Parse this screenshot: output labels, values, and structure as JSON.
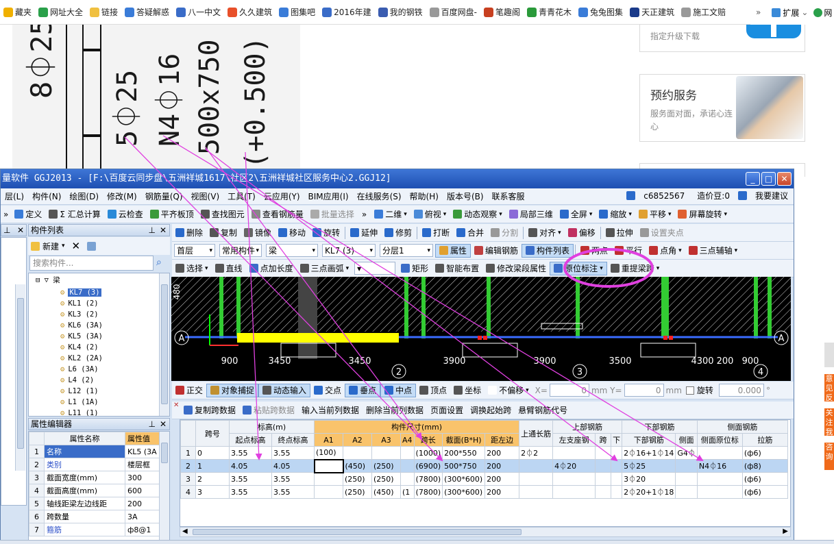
{
  "bookmarks": [
    {
      "label": "藏夹",
      "icon": "star-icon",
      "color": "#f0b000"
    },
    {
      "label": "网址大全",
      "icon": "globe-icon",
      "color": "#2aa04a"
    },
    {
      "label": "链接",
      "icon": "folder-icon",
      "color": "#f0c040"
    },
    {
      "label": "答疑解惑",
      "icon": "refresh-icon",
      "color": "#3a7cd8"
    },
    {
      "label": "八一中文",
      "icon": "arrow-icon",
      "color": "#3a6cc8"
    },
    {
      "label": "久久建筑",
      "icon": "heart-icon",
      "color": "#e8502a"
    },
    {
      "label": "图集吧",
      "icon": "book-icon",
      "color": "#3a7cd8"
    },
    {
      "label": "2016年建",
      "icon": "grid-icon",
      "color": "#3a6cc8"
    },
    {
      "label": "我的钢铁",
      "icon": "news-icon",
      "color": "#3a5cb0"
    },
    {
      "label": "百度网盘-",
      "icon": "page-icon",
      "color": "#999999"
    },
    {
      "label": "笔趣阁",
      "icon": "house-icon",
      "color": "#c84020"
    },
    {
      "label": "青青花木",
      "icon": "leaf-icon",
      "color": "#2a9a3a"
    },
    {
      "label": "兔兔图集",
      "icon": "bunny-icon",
      "color": "#3a7cd8"
    },
    {
      "label": "天正建筑",
      "icon": "house-icon",
      "color": "#1a3a8a"
    },
    {
      "label": "施工文赔",
      "icon": "page-icon",
      "color": "#999999"
    }
  ],
  "bookmarks_more": "»",
  "ext_label": "扩展",
  "ext_after": "网",
  "drawing": {
    "texts": [
      "8⏀25",
      "5⏀25",
      "N4⏀16",
      "500x750",
      "(+0.500)"
    ]
  },
  "ads": {
    "upgrade_text": "指定升级下载",
    "service_title": "预约服务",
    "service_text": "服务面对面，承诺心连心"
  },
  "side_tabs": [
    "意见反",
    "关注我",
    "咨询"
  ],
  "window": {
    "title": "量软件 GGJ2013 - [F:\\百度云同步盘\\五洲祥城1617\\社区2\\五洲祥城社区服务中心2.GGJ12]",
    "min": "_",
    "max": "□",
    "close": "✕"
  },
  "menu": {
    "items": [
      "层(L)",
      "构件(N)",
      "绘图(D)",
      "修改(M)",
      "钢筋量(Q)",
      "视图(V)",
      "工具(T)",
      "云应用(Y)",
      "BIM应用(I)",
      "在线服务(S)",
      "帮助(H)",
      "版本号(B)",
      "联系客服"
    ],
    "user": "c6852567",
    "beans": "造价豆:0",
    "suggest": "我要建议"
  },
  "toolbar1": {
    "items": [
      "定义",
      "Σ 汇总计算",
      "云检查",
      "平齐板顶",
      "查找图元",
      "查看钢筋量",
      "批量选择"
    ],
    "more": "»",
    "view": [
      "二维",
      "俯视",
      "动态观察",
      "局部三维",
      "全屏",
      "缩放",
      "平移",
      "屏幕旋转"
    ]
  },
  "component_list": {
    "header": "构件列表",
    "new_label": "新建",
    "search_placeholder": "搜索构件...",
    "root": "梁",
    "items": [
      "KL7 (3)",
      "KL1 (2)",
      "KL3 (2)",
      "KL6 (3A)",
      "KL5 (3A)",
      "KL4 (2)",
      "KL2 (2A)",
      "L6 (3A)",
      "L4 (2)",
      "L12 (1)",
      "L1 (1A)",
      "L11 (1)"
    ],
    "selected": 0
  },
  "toolbar_edit": [
    "删除",
    "复制",
    "镜像",
    "移动",
    "旋转",
    "延伸",
    "修剪",
    "打断",
    "合并",
    "分割",
    "对齐",
    "偏移",
    "拉伸",
    "设置夹点"
  ],
  "toolbar_props": {
    "floor": "首层",
    "common": "常用构件",
    "type": "梁",
    "name": "KL7 (3)",
    "layer": "分层1",
    "buttons": [
      "属性",
      "编辑钢筋",
      "构件列表"
    ],
    "draw": [
      "两点",
      "平行",
      "点角",
      "三点辅轴"
    ]
  },
  "toolbar_draw": {
    "items": [
      "选择",
      "直线",
      "点加长度",
      "三点画弧",
      "矩形",
      "智能布置",
      "修改梁段属性",
      "原位标注",
      "重提梁跨"
    ]
  },
  "canvas": {
    "dims": [
      "3450",
      "3450",
      "3900",
      "3900",
      "3500",
      "4300",
      "200",
      "900",
      "900"
    ],
    "axes_letters": [
      "A",
      "A"
    ],
    "axes_numbers": [
      "2",
      "3",
      "4"
    ],
    "left_value": "480"
  },
  "snap_bar": {
    "items": [
      "正交",
      "对象捕捉",
      "动态输入",
      "交点",
      "垂点",
      "中点",
      "顶点",
      "坐标",
      "不偏移"
    ],
    "x_label": "X=",
    "x_value": "0",
    "y_label": "mm Y=",
    "y_value": "0",
    "mm": "mm",
    "rotate_label": "旋转",
    "rotate_value": "0.000",
    "deg": "°"
  },
  "span_toolbar": [
    "复制跨数据",
    "粘贴跨数据",
    "输入当前列数据",
    "删除当前列数据",
    "页面设置",
    "调换起始跨",
    "悬臂钢筋代号"
  ],
  "props_panel": {
    "header": "属性编辑器",
    "col_name": "属性名称",
    "col_value": "属性值",
    "rows": [
      {
        "n": "1",
        "name": "名称",
        "value": "KL5 (3A"
      },
      {
        "n": "2",
        "name": "类别",
        "value": "楼层框"
      },
      {
        "n": "3",
        "name": "截面宽度(mm)",
        "value": "300"
      },
      {
        "n": "4",
        "name": "截面高度(mm)",
        "value": "600"
      },
      {
        "n": "5",
        "name": "轴线距梁左边线距",
        "value": "200"
      },
      {
        "n": "6",
        "name": "跨数量",
        "value": "3A"
      },
      {
        "n": "7",
        "name": "箍筋",
        "value": "ф8@1"
      }
    ]
  },
  "grid": {
    "headers_top": [
      "跨号",
      "标高(m)",
      "构件尺寸(mm)",
      "上通长筋",
      "上部钢筋",
      "下部钢筋",
      "侧面钢筋"
    ],
    "headers_sub": [
      "起点标高",
      "终点标高",
      "A1",
      "A2",
      "A3",
      "A4",
      "跨长",
      "截面(B*H)",
      "距左边",
      "左支座钢",
      "跨",
      "下",
      "下部钢筋",
      "侧面",
      "侧面原位标",
      "拉筋"
    ],
    "rows": [
      [
        "1",
        "0",
        "3.55",
        "3.55",
        "(100)",
        "",
        "",
        "",
        "(1000)",
        "200*550",
        "200",
        "2⏀2",
        "",
        "",
        "",
        "2⏀16+1⏀14",
        "G4⏀",
        "",
        "(ф6)"
      ],
      [
        "2",
        "1",
        "4.05",
        "4.05",
        "",
        "(450)",
        "(250)",
        "",
        "(6900)",
        "500*750",
        "200",
        "",
        "4⏀20",
        "",
        "",
        "5⏀25",
        "",
        "N4⏀16",
        "(ф8)"
      ],
      [
        "3",
        "2",
        "3.55",
        "3.55",
        "",
        "(250)",
        "(250)",
        "",
        "(7800)",
        "(300*600)",
        "200",
        "",
        "",
        "",
        "",
        "3⏀20",
        "",
        "",
        "(ф6)"
      ],
      [
        "4",
        "3",
        "3.55",
        "3.55",
        "",
        "(250)",
        "(450)",
        "(1",
        "(7800)",
        "(300*600)",
        "200",
        "",
        "",
        "",
        "",
        "2⏀20+1⏀18",
        "",
        "",
        "(ф6)"
      ]
    ],
    "selected_row": 1
  },
  "colors": {
    "annotation": "#e040e0",
    "beam": "#ffff00",
    "column": "#33cc33",
    "title": "#2058c0",
    "selected": "#bcd6f3",
    "header_orange": "#f9c36b"
  }
}
